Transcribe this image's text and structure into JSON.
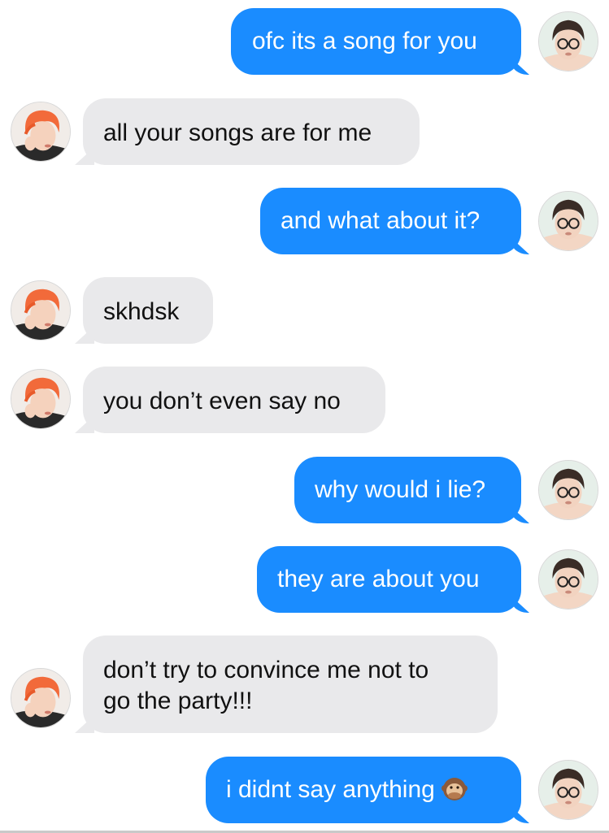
{
  "messages": [
    {
      "side": "out",
      "text": "ofc its a song for you",
      "avatar": "sender-b-avatar"
    },
    {
      "side": "in",
      "text": "all your songs are for me",
      "avatar": "sender-a-avatar"
    },
    {
      "side": "out",
      "text": "and what about it?",
      "avatar": "sender-b-avatar"
    },
    {
      "side": "in",
      "text": "skhdsk",
      "avatar": "sender-a-avatar"
    },
    {
      "side": "in",
      "text": "you don’t even say no",
      "avatar": "sender-a-avatar"
    },
    {
      "side": "out",
      "text": "why would i lie?",
      "avatar": "sender-b-avatar"
    },
    {
      "side": "out",
      "text": "they are about you",
      "avatar": "sender-b-avatar"
    },
    {
      "side": "in",
      "text_line1": "don’t try to convince me not to",
      "text_line2": "go the party!!!",
      "avatar": "sender-a-avatar"
    },
    {
      "side": "out",
      "text": "i didnt say anything",
      "emoji": "speak-no-evil-monkey-icon",
      "avatar": "sender-b-avatar"
    }
  ],
  "colors": {
    "outgoing_bubble": "#1a8cff",
    "incoming_bubble": "#e9e9eb",
    "outgoing_text": "#ffffff",
    "incoming_text": "#111111"
  }
}
